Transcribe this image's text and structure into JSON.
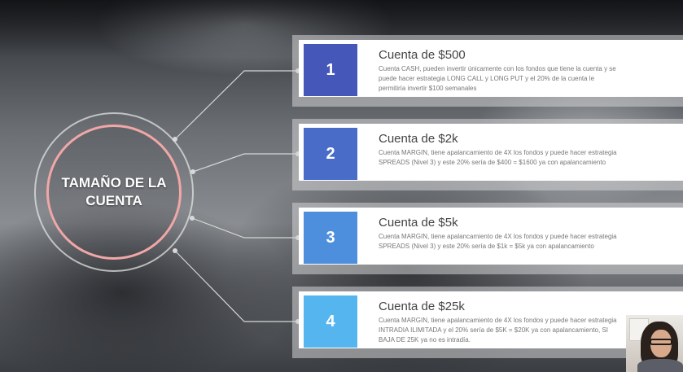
{
  "center": {
    "title": "TAMAÑO DE LA CUENTA"
  },
  "colors": [
    "#4557b8",
    "#4a6cc9",
    "#4d8fdc",
    "#55b6ef"
  ],
  "cards": [
    {
      "number": "1",
      "title": "Cuenta de $500",
      "description": "Cuenta CASH, pueden invertir únicamente con los fondos que tiene la cuenta y se puede hacer estrategia LONG CALL y LONG PUT y el 20% de la cuenta le permitiría invertir $100 semanales"
    },
    {
      "number": "2",
      "title": "Cuenta de $2k",
      "description": "Cuenta MARGIN, tiene apalancamiento de 4X los fondos y puede hacer estrategia SPREADS (Nivel 3) y este 20% sería de $400 = $1600 ya con apalancamiento"
    },
    {
      "number": "3",
      "title": "Cuenta de $5k",
      "description": "Cuenta MARGIN, tiene apalancamiento de 4X los fondos y puede hacer estrategia SPREADS (Nivel 3) y este 20% sería de $1k = $5k ya con apalancamiento"
    },
    {
      "number": "4",
      "title": "Cuenta de $25k",
      "description": "Cuenta MARGIN, tiene apalancamiento de 4X los fondos y puede hacer estrategia INTRADIA ILIMITADA y el 20% sería de $5K = $20K ya con apalancamiento, SI BAJA DE 25K ya no es intradía."
    }
  ]
}
